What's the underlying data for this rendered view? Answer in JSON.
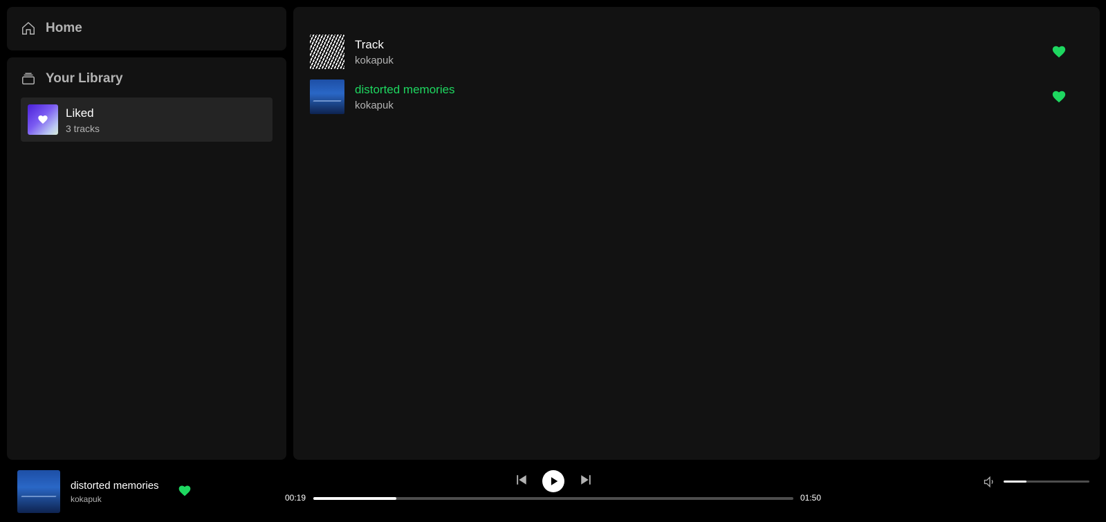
{
  "sidebar": {
    "home_label": "Home",
    "library_label": "Your Library",
    "library_items": [
      {
        "title": "Liked",
        "subtitle": "3 tracks"
      }
    ]
  },
  "tracks": [
    {
      "title": "Track",
      "artist": "kokapuk",
      "liked": true,
      "active": false
    },
    {
      "title": "distorted memories",
      "artist": "kokapuk",
      "liked": true,
      "active": true
    }
  ],
  "player": {
    "title": "distorted memories",
    "artist": "kokapuk",
    "liked": true,
    "current_time": "00:19",
    "total_time": "01:50",
    "progress_fraction": 0.1727,
    "volume_fraction": 0.27
  },
  "colors": {
    "accent": "#1ed760",
    "panel": "#121212",
    "background": "#000000"
  }
}
